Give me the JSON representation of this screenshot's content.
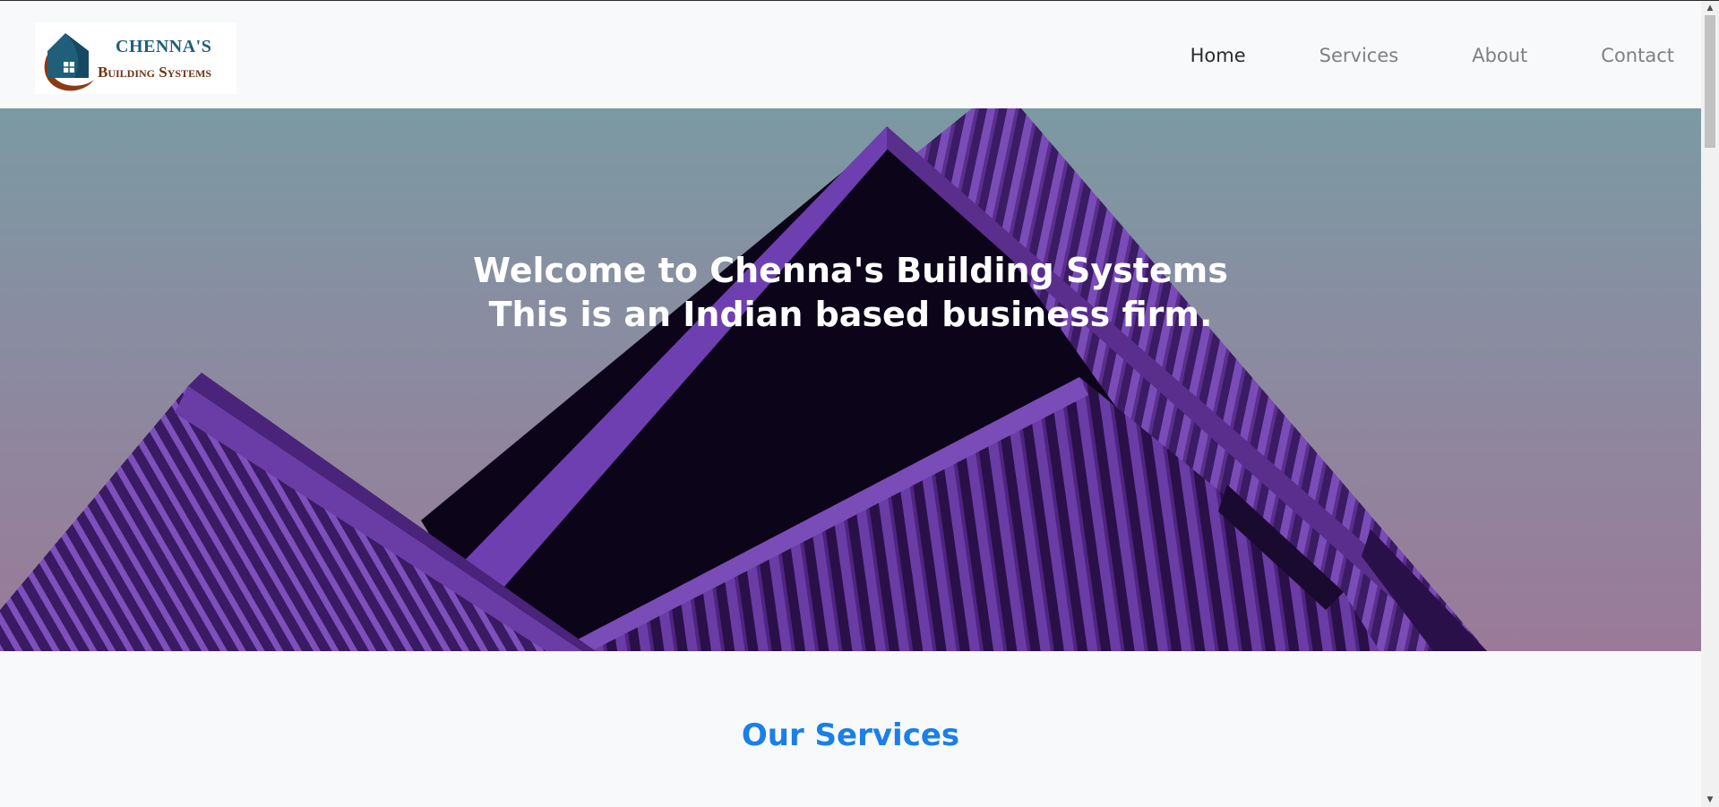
{
  "brand": {
    "name_line1": "CHENNA'S",
    "name_line2": "Building Systems"
  },
  "nav": {
    "items": [
      {
        "label": "Home",
        "active": true
      },
      {
        "label": "Services",
        "active": false
      },
      {
        "label": "About",
        "active": false
      },
      {
        "label": "Contact",
        "active": false
      }
    ]
  },
  "hero": {
    "line1": "Welcome to Chenna's Building Systems",
    "line2": "This is an Indian based business firm."
  },
  "services": {
    "title": "Our Services"
  },
  "colors": {
    "accent": "#1a7fe8",
    "brand_blue": "#1f5f7a",
    "brand_brown": "#6b3416",
    "building_purple": "#5a2e8c"
  },
  "icons": {
    "logo": "house-logo-icon",
    "scroll_up": "arrow-up-icon",
    "scroll_down": "arrow-down-icon"
  }
}
